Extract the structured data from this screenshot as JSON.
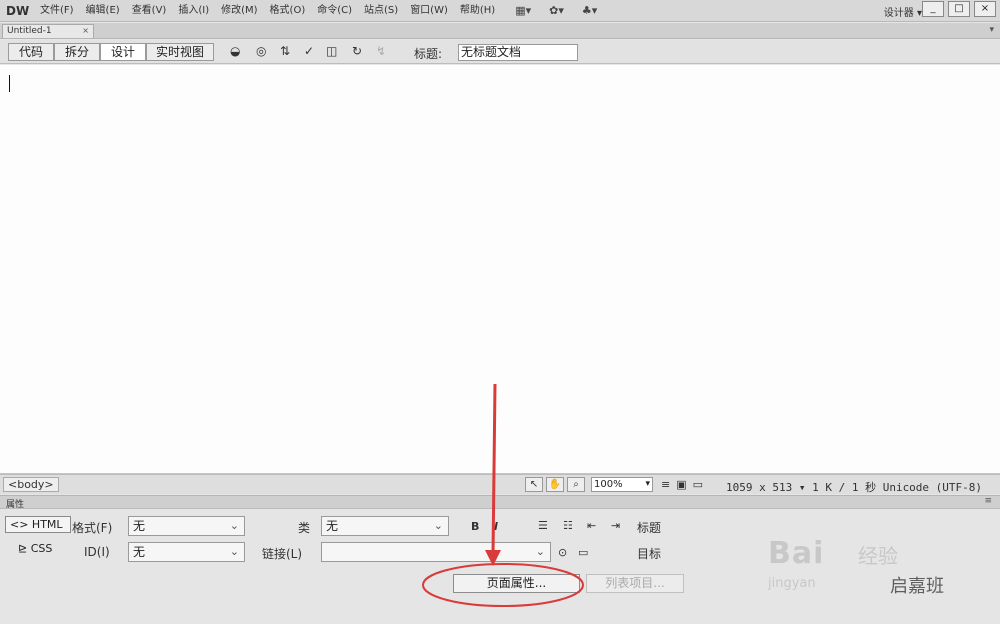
{
  "app": {
    "logo": "DW"
  },
  "menubar": {
    "items": [
      "文件(F)",
      "编辑(E)",
      "查看(V)",
      "插入(I)",
      "修改(M)",
      "格式(O)",
      "命令(C)",
      "站点(S)",
      "窗口(W)",
      "帮助(H)"
    ],
    "workspace": "设计器",
    "window_buttons": [
      "_",
      "□",
      "×"
    ]
  },
  "document": {
    "tab_name": "Untitled-1",
    "view_buttons": [
      "代码",
      "拆分",
      "设计",
      "实时视图"
    ],
    "active_view": "设计",
    "title_label": "标题:",
    "title_value": "无标题文档"
  },
  "statusbar": {
    "tag": "<body>",
    "zoom": "100%",
    "info": "1059 x 513 ▾ 1 K / 1 秒 Unicode (UTF-8)"
  },
  "properties": {
    "panel_title": "属性",
    "modes": [
      "<> HTML",
      "CSS"
    ],
    "active_mode": "<> HTML",
    "format_label": "格式(F)",
    "format_value": "无",
    "class_label": "类",
    "class_value": "无",
    "id_label": "ID(I)",
    "id_value": "无",
    "link_label": "链接(L)",
    "link_value": "",
    "bold": "B",
    "italic": "I",
    "heading_label": "标题",
    "target_label": "目标",
    "page_properties_button": "页面属性...",
    "list_item_button": "列表项目..."
  },
  "annotation": {
    "color": "#d93a3a"
  },
  "watermark": {
    "brand": "Bai",
    "sub": "经验",
    "small": "jingyan",
    "account": "启嘉班"
  }
}
